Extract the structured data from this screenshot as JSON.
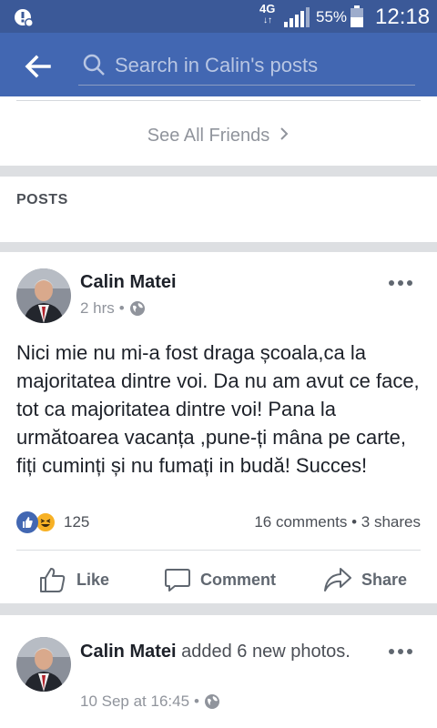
{
  "status_bar": {
    "network": "4G",
    "network_arrows": "↓↑",
    "battery": "55%",
    "time": "12:18"
  },
  "app_bar": {
    "search_placeholder": "Search in Calin's posts"
  },
  "friends": {
    "see_all_label": "See All Friends"
  },
  "posts_section": {
    "heading": "POSTS"
  },
  "posts": [
    {
      "author": "Calin Matei",
      "time": "2 hrs",
      "text": "Nici mie nu mi-a fost draga școala,ca la majoritatea dintre voi. Da nu am avut ce face, tot ca majoritatea dintre voi! Pana la următoarea vacanța ,pune-ți mâna pe carte, fiți cuminți și nu fumați in budă! Succes!",
      "reaction_count": "125",
      "counts": "16 comments • 3 shares",
      "actions": {
        "like": "Like",
        "comment": "Comment",
        "share": "Share"
      }
    },
    {
      "author": "Calin Matei",
      "action": " added 6 new photos.",
      "time": "10 Sep at 16:45"
    }
  ],
  "colors": {
    "status_bar": "#3b5998",
    "app_bar": "#4267b2",
    "like_blue": "#4267b2",
    "haha_yellow": "#f7b125"
  }
}
